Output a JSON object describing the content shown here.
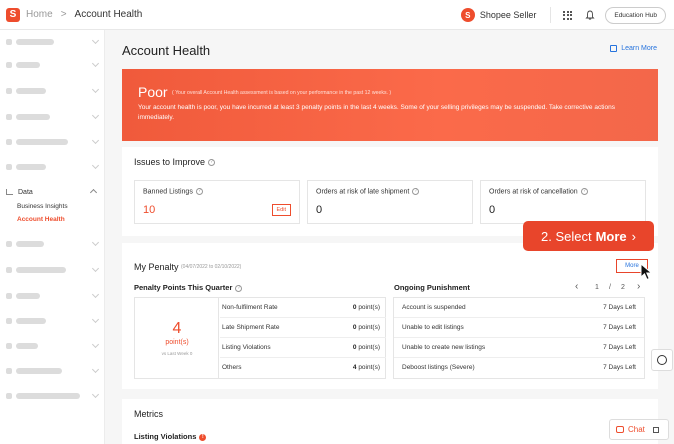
{
  "topbar": {
    "logo_letter": "S",
    "breadcrumb_home": "Home",
    "breadcrumb_sep": ">",
    "breadcrumb_current": "Account Health",
    "seller_logo_letter": "S",
    "seller_label": "Shopee Seller",
    "education_hub": "Education Hub"
  },
  "sidebar": {
    "data_label": "Data",
    "sub_items": [
      {
        "label": "Business Insights",
        "active": false
      },
      {
        "label": "Account Health",
        "active": true
      }
    ]
  },
  "page": {
    "title": "Account Health",
    "learn_more": "Learn More"
  },
  "banner": {
    "level": "Poor",
    "level_note": "( Your overall Account Health assessment is based on your performance in the past 12 weeks. )",
    "description": "Your account health is poor, you have incurred at least 3 penalty points in the last 4 weeks. Some of your selling privileges may be suspended. Take corrective actions immediately."
  },
  "issues": {
    "title": "Issues to Improve",
    "help": "?",
    "items": [
      {
        "label": "Banned Listings",
        "value": "10",
        "action": "Edit"
      },
      {
        "label": "Orders at risk of late shipment",
        "value": "0"
      },
      {
        "label": "Orders at risk of cancellation",
        "value": "0"
      }
    ]
  },
  "penalty": {
    "title": "My Penalty",
    "date_range": "(04/07/2022 to 02/10/2022)",
    "callout_prefix": "2. Select",
    "callout_bold": "More",
    "callout_arrow": "›",
    "more_label": "More",
    "points_title": "Penalty Points This Quarter",
    "points_total": "4",
    "points_unit": "point(s)",
    "points_note": "vs Last Week 0",
    "point_rows": [
      {
        "label": "Non-fulfilment Rate",
        "value": "0",
        "unit": "point(s)"
      },
      {
        "label": "Late Shipment Rate",
        "value": "0",
        "unit": "point(s)"
      },
      {
        "label": "Listing Violations",
        "value": "0",
        "unit": "point(s)"
      },
      {
        "label": "Others",
        "value": "4",
        "unit": "point(s)"
      }
    ],
    "punishment_title": "Ongoing Punishment",
    "pager_prev": "‹",
    "pager_current": "1",
    "pager_sep": "/",
    "pager_total": "2",
    "pager_next": "›",
    "punishments": [
      {
        "label": "Account is suspended",
        "value": "7 Days Left"
      },
      {
        "label": "Unable to edit listings",
        "value": "7 Days Left"
      },
      {
        "label": "Unable to create new listings",
        "value": "7 Days Left"
      },
      {
        "label": "Deboost listings (Severe)",
        "value": "7 Days Left"
      }
    ]
  },
  "metrics": {
    "title": "Metrics",
    "listing_violations": "Listing Violations",
    "violation_count": "!"
  },
  "chat": {
    "label": "Chat"
  },
  "colors": {
    "accent": "#ee4d2d",
    "link": "#2673dd",
    "callout": "#e8452b"
  }
}
